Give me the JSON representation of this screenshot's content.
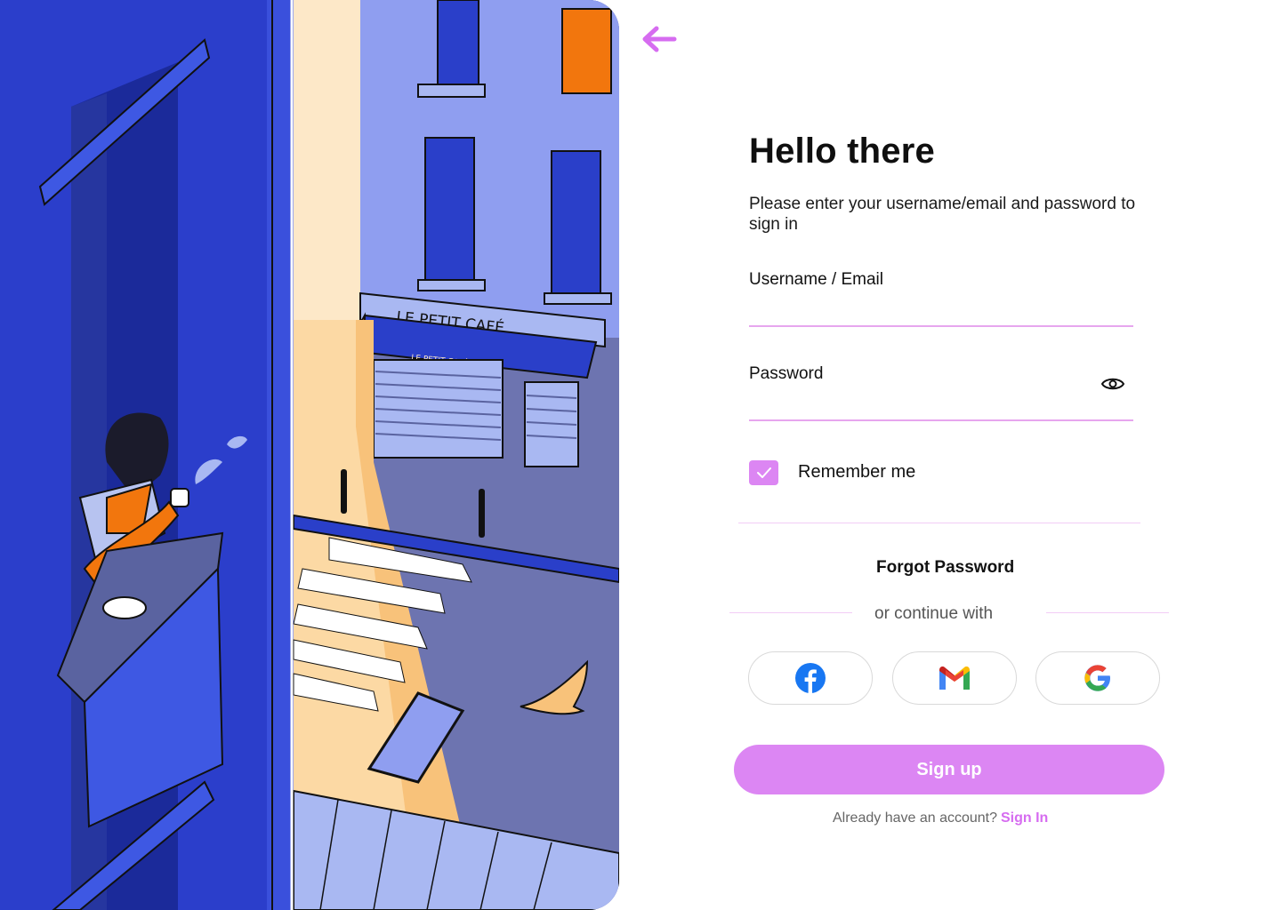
{
  "colors": {
    "accent": "#dc86f3",
    "accent_line": "#e7a6ee",
    "illustration_blue": "#2a3fc9"
  },
  "illustration": {
    "sign_text": "LE PETIT CAFÉ",
    "awning_text": "LE PETIT CAFÉ"
  },
  "header": {
    "back_icon": "arrow-left-icon"
  },
  "form": {
    "title": "Hello there",
    "subtitle": "Please enter your username/email and password to sign in",
    "username_label": "Username / Email",
    "username_value": "",
    "password_label": "Password",
    "password_value": "",
    "remember_label": "Remember me",
    "remember_checked": true,
    "forgot_label": "Forgot Password",
    "continue_text": "or continue with"
  },
  "social": [
    {
      "icon": "facebook-icon"
    },
    {
      "icon": "gmail-icon"
    },
    {
      "icon": "google-icon"
    }
  ],
  "footer": {
    "signup_label": "Sign up",
    "have_account_text": "Already have an account?",
    "signin_label": "Sign In"
  }
}
